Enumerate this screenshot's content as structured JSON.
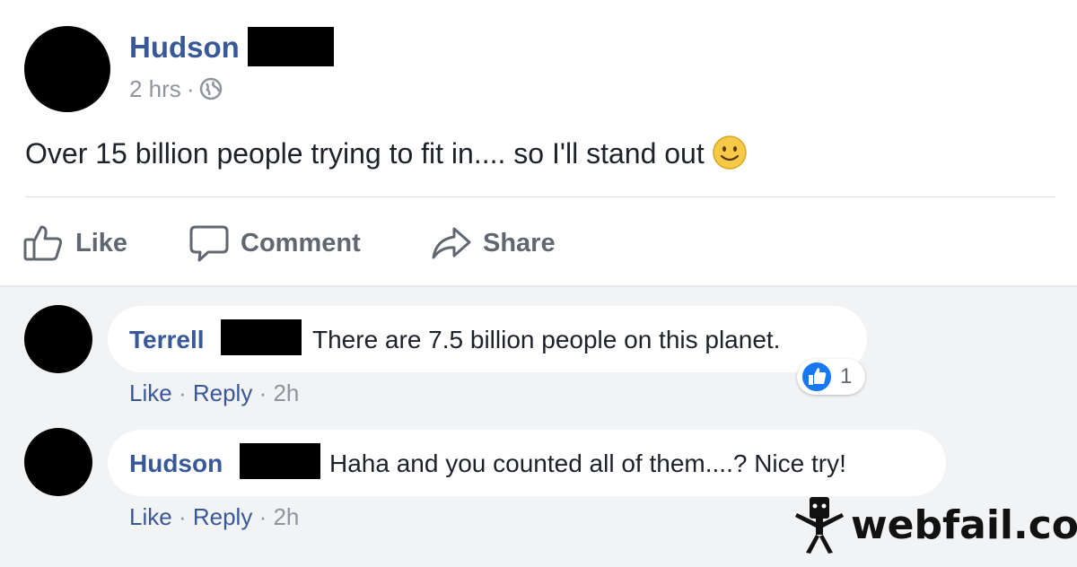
{
  "post": {
    "author": "Hudson",
    "time": "2 hrs",
    "separator": "·",
    "audience_icon": "globe-icon",
    "text": "Over 15 billion people trying to fit in.... so I'll stand out",
    "emoji": "smiley-emoji"
  },
  "actions": {
    "like": "Like",
    "comment": "Comment",
    "share": "Share"
  },
  "comments": [
    {
      "author": "Terrell",
      "text": "There are 7.5 billion people on this planet.",
      "like": "Like",
      "reply": "Reply",
      "sep": "·",
      "time": "2h",
      "reaction_count": "1"
    },
    {
      "author": "Hudson",
      "text": "Haha and you counted all of them....? Nice try!",
      "like": "Like",
      "reply": "Reply",
      "sep": "·",
      "time": "2h"
    }
  ],
  "watermark": {
    "brand": "webfail.com"
  },
  "colors": {
    "link": "#385898",
    "muted": "#90949c",
    "comment_bg": "#f2f3f5",
    "like_blue": "#1877f2"
  }
}
